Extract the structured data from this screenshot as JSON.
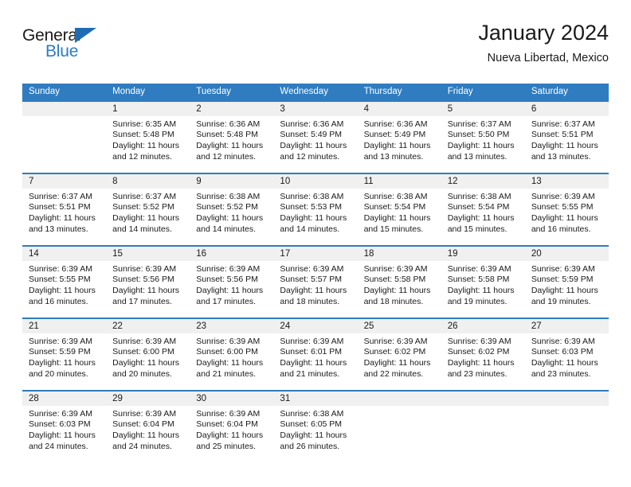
{
  "brand": {
    "name_top": "General",
    "name_bottom": "Blue",
    "triangle_icon": "brand-triangle-icon",
    "accent_color": "#2a7cc7"
  },
  "header": {
    "title": "January 2024",
    "subtitle": "Nueva Libertad, Mexico"
  },
  "theme": {
    "header_bg": "#2f7cc0",
    "day_band_bg": "#f0f0f0",
    "grid_line": "#2f7cc0",
    "text": "#1a1a1a"
  },
  "weekdays": [
    "Sunday",
    "Monday",
    "Tuesday",
    "Wednesday",
    "Thursday",
    "Friday",
    "Saturday"
  ],
  "labels": {
    "sunrise_prefix": "Sunrise:",
    "sunset_prefix": "Sunset:",
    "daylight_prefix": "Daylight:"
  },
  "weeks": [
    [
      {
        "day": "",
        "sunrise": "",
        "sunset": "",
        "daylight_l1": "",
        "daylight_l2": ""
      },
      {
        "day": "1",
        "sunrise": "Sunrise: 6:35 AM",
        "sunset": "Sunset: 5:48 PM",
        "daylight_l1": "Daylight: 11 hours",
        "daylight_l2": "and 12 minutes."
      },
      {
        "day": "2",
        "sunrise": "Sunrise: 6:36 AM",
        "sunset": "Sunset: 5:48 PM",
        "daylight_l1": "Daylight: 11 hours",
        "daylight_l2": "and 12 minutes."
      },
      {
        "day": "3",
        "sunrise": "Sunrise: 6:36 AM",
        "sunset": "Sunset: 5:49 PM",
        "daylight_l1": "Daylight: 11 hours",
        "daylight_l2": "and 12 minutes."
      },
      {
        "day": "4",
        "sunrise": "Sunrise: 6:36 AM",
        "sunset": "Sunset: 5:49 PM",
        "daylight_l1": "Daylight: 11 hours",
        "daylight_l2": "and 13 minutes."
      },
      {
        "day": "5",
        "sunrise": "Sunrise: 6:37 AM",
        "sunset": "Sunset: 5:50 PM",
        "daylight_l1": "Daylight: 11 hours",
        "daylight_l2": "and 13 minutes."
      },
      {
        "day": "6",
        "sunrise": "Sunrise: 6:37 AM",
        "sunset": "Sunset: 5:51 PM",
        "daylight_l1": "Daylight: 11 hours",
        "daylight_l2": "and 13 minutes."
      }
    ],
    [
      {
        "day": "7",
        "sunrise": "Sunrise: 6:37 AM",
        "sunset": "Sunset: 5:51 PM",
        "daylight_l1": "Daylight: 11 hours",
        "daylight_l2": "and 13 minutes."
      },
      {
        "day": "8",
        "sunrise": "Sunrise: 6:37 AM",
        "sunset": "Sunset: 5:52 PM",
        "daylight_l1": "Daylight: 11 hours",
        "daylight_l2": "and 14 minutes."
      },
      {
        "day": "9",
        "sunrise": "Sunrise: 6:38 AM",
        "sunset": "Sunset: 5:52 PM",
        "daylight_l1": "Daylight: 11 hours",
        "daylight_l2": "and 14 minutes."
      },
      {
        "day": "10",
        "sunrise": "Sunrise: 6:38 AM",
        "sunset": "Sunset: 5:53 PM",
        "daylight_l1": "Daylight: 11 hours",
        "daylight_l2": "and 14 minutes."
      },
      {
        "day": "11",
        "sunrise": "Sunrise: 6:38 AM",
        "sunset": "Sunset: 5:54 PM",
        "daylight_l1": "Daylight: 11 hours",
        "daylight_l2": "and 15 minutes."
      },
      {
        "day": "12",
        "sunrise": "Sunrise: 6:38 AM",
        "sunset": "Sunset: 5:54 PM",
        "daylight_l1": "Daylight: 11 hours",
        "daylight_l2": "and 15 minutes."
      },
      {
        "day": "13",
        "sunrise": "Sunrise: 6:39 AM",
        "sunset": "Sunset: 5:55 PM",
        "daylight_l1": "Daylight: 11 hours",
        "daylight_l2": "and 16 minutes."
      }
    ],
    [
      {
        "day": "14",
        "sunrise": "Sunrise: 6:39 AM",
        "sunset": "Sunset: 5:55 PM",
        "daylight_l1": "Daylight: 11 hours",
        "daylight_l2": "and 16 minutes."
      },
      {
        "day": "15",
        "sunrise": "Sunrise: 6:39 AM",
        "sunset": "Sunset: 5:56 PM",
        "daylight_l1": "Daylight: 11 hours",
        "daylight_l2": "and 17 minutes."
      },
      {
        "day": "16",
        "sunrise": "Sunrise: 6:39 AM",
        "sunset": "Sunset: 5:56 PM",
        "daylight_l1": "Daylight: 11 hours",
        "daylight_l2": "and 17 minutes."
      },
      {
        "day": "17",
        "sunrise": "Sunrise: 6:39 AM",
        "sunset": "Sunset: 5:57 PM",
        "daylight_l1": "Daylight: 11 hours",
        "daylight_l2": "and 18 minutes."
      },
      {
        "day": "18",
        "sunrise": "Sunrise: 6:39 AM",
        "sunset": "Sunset: 5:58 PM",
        "daylight_l1": "Daylight: 11 hours",
        "daylight_l2": "and 18 minutes."
      },
      {
        "day": "19",
        "sunrise": "Sunrise: 6:39 AM",
        "sunset": "Sunset: 5:58 PM",
        "daylight_l1": "Daylight: 11 hours",
        "daylight_l2": "and 19 minutes."
      },
      {
        "day": "20",
        "sunrise": "Sunrise: 6:39 AM",
        "sunset": "Sunset: 5:59 PM",
        "daylight_l1": "Daylight: 11 hours",
        "daylight_l2": "and 19 minutes."
      }
    ],
    [
      {
        "day": "21",
        "sunrise": "Sunrise: 6:39 AM",
        "sunset": "Sunset: 5:59 PM",
        "daylight_l1": "Daylight: 11 hours",
        "daylight_l2": "and 20 minutes."
      },
      {
        "day": "22",
        "sunrise": "Sunrise: 6:39 AM",
        "sunset": "Sunset: 6:00 PM",
        "daylight_l1": "Daylight: 11 hours",
        "daylight_l2": "and 20 minutes."
      },
      {
        "day": "23",
        "sunrise": "Sunrise: 6:39 AM",
        "sunset": "Sunset: 6:00 PM",
        "daylight_l1": "Daylight: 11 hours",
        "daylight_l2": "and 21 minutes."
      },
      {
        "day": "24",
        "sunrise": "Sunrise: 6:39 AM",
        "sunset": "Sunset: 6:01 PM",
        "daylight_l1": "Daylight: 11 hours",
        "daylight_l2": "and 21 minutes."
      },
      {
        "day": "25",
        "sunrise": "Sunrise: 6:39 AM",
        "sunset": "Sunset: 6:02 PM",
        "daylight_l1": "Daylight: 11 hours",
        "daylight_l2": "and 22 minutes."
      },
      {
        "day": "26",
        "sunrise": "Sunrise: 6:39 AM",
        "sunset": "Sunset: 6:02 PM",
        "daylight_l1": "Daylight: 11 hours",
        "daylight_l2": "and 23 minutes."
      },
      {
        "day": "27",
        "sunrise": "Sunrise: 6:39 AM",
        "sunset": "Sunset: 6:03 PM",
        "daylight_l1": "Daylight: 11 hours",
        "daylight_l2": "and 23 minutes."
      }
    ],
    [
      {
        "day": "28",
        "sunrise": "Sunrise: 6:39 AM",
        "sunset": "Sunset: 6:03 PM",
        "daylight_l1": "Daylight: 11 hours",
        "daylight_l2": "and 24 minutes."
      },
      {
        "day": "29",
        "sunrise": "Sunrise: 6:39 AM",
        "sunset": "Sunset: 6:04 PM",
        "daylight_l1": "Daylight: 11 hours",
        "daylight_l2": "and 24 minutes."
      },
      {
        "day": "30",
        "sunrise": "Sunrise: 6:39 AM",
        "sunset": "Sunset: 6:04 PM",
        "daylight_l1": "Daylight: 11 hours",
        "daylight_l2": "and 25 minutes."
      },
      {
        "day": "31",
        "sunrise": "Sunrise: 6:38 AM",
        "sunset": "Sunset: 6:05 PM",
        "daylight_l1": "Daylight: 11 hours",
        "daylight_l2": "and 26 minutes."
      },
      {
        "day": "",
        "sunrise": "",
        "sunset": "",
        "daylight_l1": "",
        "daylight_l2": ""
      },
      {
        "day": "",
        "sunrise": "",
        "sunset": "",
        "daylight_l1": "",
        "daylight_l2": ""
      },
      {
        "day": "",
        "sunrise": "",
        "sunset": "",
        "daylight_l1": "",
        "daylight_l2": ""
      }
    ]
  ]
}
